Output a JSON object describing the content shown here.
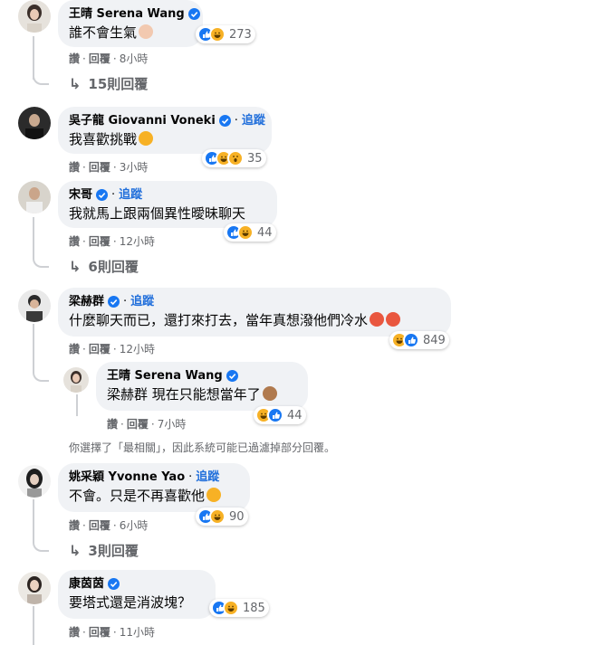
{
  "colors": {
    "bubble": "#f0f2f5",
    "link": "#216fdb",
    "meta": "#65676b",
    "verified": "#1877f2",
    "like": "#1877f2",
    "haha": "#f7b125"
  },
  "actions": {
    "like": "讚",
    "reply": "回覆",
    "follow": "追蹤"
  },
  "comments": [
    {
      "name": "王晴 Serena Wang",
      "text": "誰不會生氣",
      "time": "8小時",
      "reaction_count": "273",
      "replies": "15則回覆"
    },
    {
      "name": "吳子龍 Giovanni Voneki",
      "text": "我喜歡挑戰",
      "time": "3小時",
      "reaction_count": "35"
    },
    {
      "name": "宋哥",
      "text": "我就馬上跟兩個異性曖昧聊天",
      "time": "12小時",
      "reaction_count": "44",
      "replies": "6則回覆"
    },
    {
      "name": "梁赫群",
      "text": "什麼聊天而已，還打來打去，當年真想潑他們冷水",
      "time": "12小時",
      "reaction_count": "849"
    },
    {
      "name": "王晴 Serena Wang",
      "mention": "梁赫群",
      "text": "現在只能想當年了",
      "time": "7小時",
      "reaction_count": "44"
    },
    {
      "name": "姚采穎 Yvonne Yao",
      "text": "不會。只是不再喜歡他",
      "time": "6小時",
      "reaction_count": "90",
      "replies": "3則回覆"
    },
    {
      "name": "康茵茵",
      "text": "要塔式還是消波塊？",
      "time": "11小時",
      "reaction_count": "185"
    }
  ],
  "notice": "你選擇了「最相關」，因此系統可能已過濾掉部分回覆。"
}
